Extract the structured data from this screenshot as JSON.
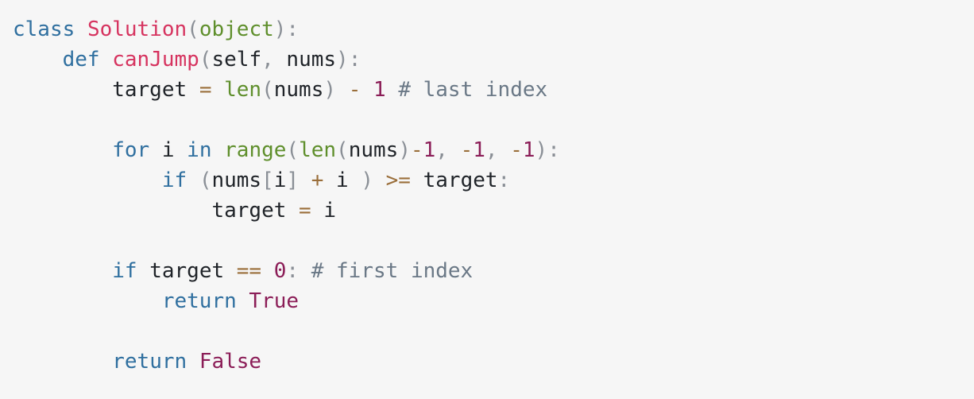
{
  "colors": {
    "background": "#f6f6f6",
    "keyword": "#2f6f9f",
    "name": "#d6335f",
    "builtin": "#5f8f2c",
    "number": "#8b1d57",
    "constant": "#8b1d57",
    "operator": "#9a6e3a",
    "punctuation": "#8a8f96",
    "comment": "#6a7886",
    "identifier": "#1f2328"
  },
  "code": {
    "lines": [
      [
        {
          "text": "class",
          "kind": "keyword"
        },
        {
          "text": " ",
          "kind": "identifier"
        },
        {
          "text": "Solution",
          "kind": "name"
        },
        {
          "text": "(",
          "kind": "punctuation"
        },
        {
          "text": "object",
          "kind": "builtin"
        },
        {
          "text": "):",
          "kind": "punctuation"
        }
      ],
      [
        {
          "text": "    ",
          "kind": "identifier"
        },
        {
          "text": "def",
          "kind": "keyword"
        },
        {
          "text": " ",
          "kind": "identifier"
        },
        {
          "text": "canJump",
          "kind": "name"
        },
        {
          "text": "(",
          "kind": "punctuation"
        },
        {
          "text": "self",
          "kind": "identifier"
        },
        {
          "text": ", ",
          "kind": "punctuation"
        },
        {
          "text": "nums",
          "kind": "identifier"
        },
        {
          "text": "):",
          "kind": "punctuation"
        }
      ],
      [
        {
          "text": "        target ",
          "kind": "identifier"
        },
        {
          "text": "=",
          "kind": "operator"
        },
        {
          "text": " ",
          "kind": "identifier"
        },
        {
          "text": "len",
          "kind": "builtin"
        },
        {
          "text": "(",
          "kind": "punctuation"
        },
        {
          "text": "nums",
          "kind": "identifier"
        },
        {
          "text": ")",
          "kind": "punctuation"
        },
        {
          "text": " ",
          "kind": "identifier"
        },
        {
          "text": "-",
          "kind": "operator"
        },
        {
          "text": " ",
          "kind": "identifier"
        },
        {
          "text": "1",
          "kind": "number"
        },
        {
          "text": " ",
          "kind": "identifier"
        },
        {
          "text": "# last index",
          "kind": "comment"
        }
      ],
      [],
      [
        {
          "text": "        ",
          "kind": "identifier"
        },
        {
          "text": "for",
          "kind": "keyword"
        },
        {
          "text": " i ",
          "kind": "identifier"
        },
        {
          "text": "in",
          "kind": "keyword"
        },
        {
          "text": " ",
          "kind": "identifier"
        },
        {
          "text": "range",
          "kind": "builtin"
        },
        {
          "text": "(",
          "kind": "punctuation"
        },
        {
          "text": "len",
          "kind": "builtin"
        },
        {
          "text": "(",
          "kind": "punctuation"
        },
        {
          "text": "nums",
          "kind": "identifier"
        },
        {
          "text": ")",
          "kind": "punctuation"
        },
        {
          "text": "-",
          "kind": "operator"
        },
        {
          "text": "1",
          "kind": "number"
        },
        {
          "text": ", ",
          "kind": "punctuation"
        },
        {
          "text": "-",
          "kind": "operator"
        },
        {
          "text": "1",
          "kind": "number"
        },
        {
          "text": ", ",
          "kind": "punctuation"
        },
        {
          "text": "-",
          "kind": "operator"
        },
        {
          "text": "1",
          "kind": "number"
        },
        {
          "text": "):",
          "kind": "punctuation"
        }
      ],
      [
        {
          "text": "            ",
          "kind": "identifier"
        },
        {
          "text": "if",
          "kind": "keyword"
        },
        {
          "text": " ",
          "kind": "identifier"
        },
        {
          "text": "(",
          "kind": "punctuation"
        },
        {
          "text": "nums",
          "kind": "identifier"
        },
        {
          "text": "[",
          "kind": "punctuation"
        },
        {
          "text": "i",
          "kind": "identifier"
        },
        {
          "text": "]",
          "kind": "punctuation"
        },
        {
          "text": " ",
          "kind": "identifier"
        },
        {
          "text": "+",
          "kind": "operator"
        },
        {
          "text": " i ",
          "kind": "identifier"
        },
        {
          "text": ")",
          "kind": "punctuation"
        },
        {
          "text": " ",
          "kind": "identifier"
        },
        {
          "text": ">=",
          "kind": "operator"
        },
        {
          "text": " target",
          "kind": "identifier"
        },
        {
          "text": ":",
          "kind": "punctuation"
        }
      ],
      [
        {
          "text": "                target ",
          "kind": "identifier"
        },
        {
          "text": "=",
          "kind": "operator"
        },
        {
          "text": " i",
          "kind": "identifier"
        }
      ],
      [],
      [
        {
          "text": "        ",
          "kind": "identifier"
        },
        {
          "text": "if",
          "kind": "keyword"
        },
        {
          "text": " target ",
          "kind": "identifier"
        },
        {
          "text": "==",
          "kind": "operator"
        },
        {
          "text": " ",
          "kind": "identifier"
        },
        {
          "text": "0",
          "kind": "number"
        },
        {
          "text": ":",
          "kind": "punctuation"
        },
        {
          "text": " ",
          "kind": "identifier"
        },
        {
          "text": "# first index",
          "kind": "comment"
        }
      ],
      [
        {
          "text": "            ",
          "kind": "identifier"
        },
        {
          "text": "return",
          "kind": "keyword"
        },
        {
          "text": " ",
          "kind": "identifier"
        },
        {
          "text": "True",
          "kind": "constant"
        }
      ],
      [],
      [
        {
          "text": "        ",
          "kind": "identifier"
        },
        {
          "text": "return",
          "kind": "keyword"
        },
        {
          "text": " ",
          "kind": "identifier"
        },
        {
          "text": "False",
          "kind": "constant"
        }
      ]
    ]
  }
}
